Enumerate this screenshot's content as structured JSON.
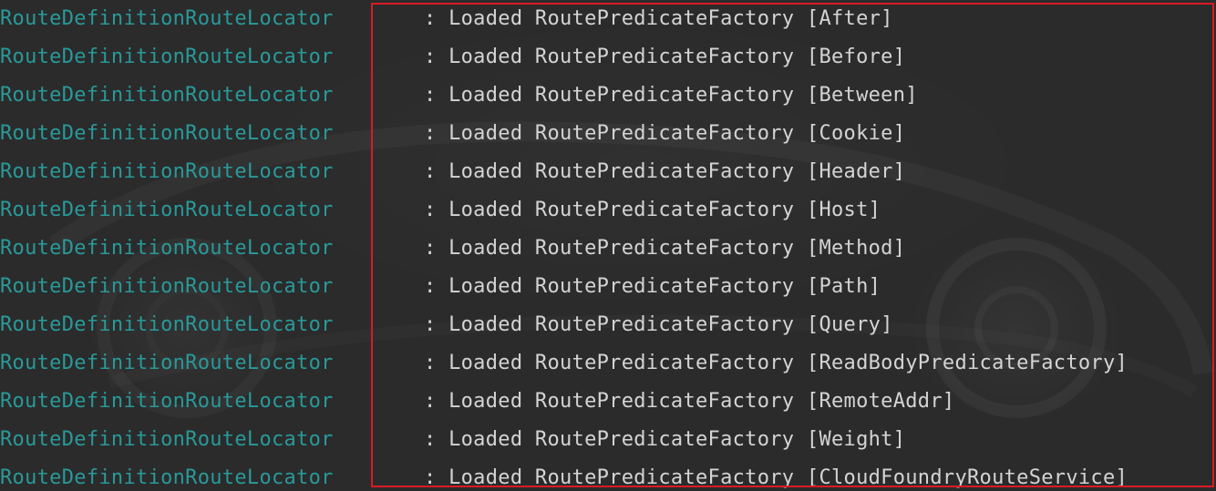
{
  "console": {
    "lines": [
      {
        "logger": "RouteDefinitionRouteLocator",
        "message": ": Loaded RoutePredicateFactory [After]"
      },
      {
        "logger": "RouteDefinitionRouteLocator",
        "message": ": Loaded RoutePredicateFactory [Before]"
      },
      {
        "logger": "RouteDefinitionRouteLocator",
        "message": ": Loaded RoutePredicateFactory [Between]"
      },
      {
        "logger": "RouteDefinitionRouteLocator",
        "message": ": Loaded RoutePredicateFactory [Cookie]"
      },
      {
        "logger": "RouteDefinitionRouteLocator",
        "message": ": Loaded RoutePredicateFactory [Header]"
      },
      {
        "logger": "RouteDefinitionRouteLocator",
        "message": ": Loaded RoutePredicateFactory [Host]"
      },
      {
        "logger": "RouteDefinitionRouteLocator",
        "message": ": Loaded RoutePredicateFactory [Method]"
      },
      {
        "logger": "RouteDefinitionRouteLocator",
        "message": ": Loaded RoutePredicateFactory [Path]"
      },
      {
        "logger": "RouteDefinitionRouteLocator",
        "message": ": Loaded RoutePredicateFactory [Query]"
      },
      {
        "logger": "RouteDefinitionRouteLocator",
        "message": ": Loaded RoutePredicateFactory [ReadBodyPredicateFactory]"
      },
      {
        "logger": "RouteDefinitionRouteLocator",
        "message": ": Loaded RoutePredicateFactory [RemoteAddr]"
      },
      {
        "logger": "RouteDefinitionRouteLocator",
        "message": ": Loaded RoutePredicateFactory [Weight]"
      },
      {
        "logger": "RouteDefinitionRouteLocator",
        "message": ": Loaded RoutePredicateFactory [CloudFoundryRouteService]"
      }
    ]
  },
  "colors": {
    "background": "#2b2b2b",
    "logger_text": "#299999",
    "message_text": "#d4d4d4",
    "highlight_border": "#d91a24"
  }
}
